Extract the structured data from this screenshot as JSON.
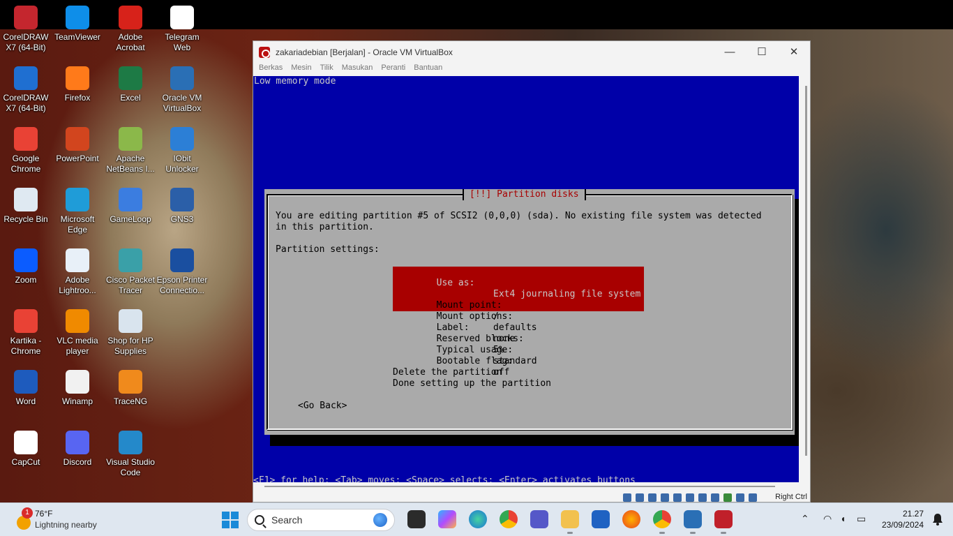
{
  "desktop": {
    "icons": [
      {
        "label": "CorelDRAW X7 (64-Bit)",
        "icon": "coreldraw-icon",
        "color": "#c4262e"
      },
      {
        "label": "TeamViewer",
        "icon": "teamviewer-icon",
        "color": "#0e8ee9"
      },
      {
        "label": "Adobe Acrobat",
        "icon": "acrobat-icon",
        "color": "#d7221a"
      },
      {
        "label": "Telegram Web",
        "icon": "file-icon",
        "color": "#ffffff"
      },
      {
        "label": "CorelDRAW X7 (64-Bit)",
        "icon": "document-icon",
        "color": "#1f6fd1"
      },
      {
        "label": "Firefox",
        "icon": "firefox-icon",
        "color": "#ff7a1a"
      },
      {
        "label": "Excel",
        "icon": "excel-icon",
        "color": "#1d7a45"
      },
      {
        "label": "Oracle VM VirtualBox",
        "icon": "virtualbox-icon",
        "color": "#2a6fb5"
      },
      {
        "label": "Google Chrome",
        "icon": "chrome-icon",
        "color": "#e94235"
      },
      {
        "label": "PowerPoint",
        "icon": "powerpoint-icon",
        "color": "#d2451e"
      },
      {
        "label": "Apache NetBeans I...",
        "icon": "netbeans-icon",
        "color": "#8bb84a"
      },
      {
        "label": "IObit Unlocker",
        "icon": "unlocker-icon",
        "color": "#2c7fd6"
      },
      {
        "label": "Recycle Bin",
        "icon": "recycle-bin-icon",
        "color": "#dfe9f2"
      },
      {
        "label": "Microsoft Edge",
        "icon": "edge-icon",
        "color": "#1f9cd8"
      },
      {
        "label": "GameLoop",
        "icon": "gameloop-icon",
        "color": "#3b7de0"
      },
      {
        "label": "GNS3",
        "icon": "gns3-icon",
        "color": "#2b5fa8"
      },
      {
        "label": "Zoom",
        "icon": "zoom-icon",
        "color": "#0b5cff"
      },
      {
        "label": "Adobe Lightroo...",
        "icon": "lightroom-icon",
        "color": "#e8f0f8"
      },
      {
        "label": "Cisco Packet Tracer",
        "icon": "packet-tracer-icon",
        "color": "#3aa0a8"
      },
      {
        "label": "Epson Printer Connectio...",
        "icon": "epson-icon",
        "color": "#1a4fa0"
      },
      {
        "label": "Kartika - Chrome",
        "icon": "chrome-profile-icon",
        "color": "#e94235"
      },
      {
        "label": "VLC media player",
        "icon": "vlc-icon",
        "color": "#f08a00"
      },
      {
        "label": "Shop for HP Supplies",
        "icon": "hp-printer-icon",
        "color": "#d9e4ee"
      },
      {
        "label": "",
        "icon": "none",
        "color": ""
      },
      {
        "label": "Word",
        "icon": "word-icon",
        "color": "#1e5bbd"
      },
      {
        "label": "Winamp",
        "icon": "winamp-icon",
        "color": "#f1f1f1"
      },
      {
        "label": "TraceNG",
        "icon": "traceng-icon",
        "color": "#f08a1c"
      },
      {
        "label": "",
        "icon": "none",
        "color": ""
      },
      {
        "label": "CapCut",
        "icon": "capcut-icon",
        "color": "#ffffff"
      },
      {
        "label": "Discord",
        "icon": "discord-icon",
        "color": "#5865f2"
      },
      {
        "label": "Visual Studio Code",
        "icon": "vscode-icon",
        "color": "#2489ca"
      }
    ]
  },
  "vbox": {
    "title": "zakariadebian [Berjalan] - Oracle VM VirtualBox",
    "menu": [
      "Berkas",
      "Mesin",
      "Tilik",
      "Masukan",
      "Peranti",
      "Bantuan"
    ],
    "window_buttons": {
      "minimize": "—",
      "maximize": "☐",
      "close": "✕"
    },
    "status_right": "Right Ctrl"
  },
  "installer": {
    "low_memory": "Low memory mode",
    "dialog_title": "[!!] Partition disks",
    "intro_line1": "You are editing partition #5 of SCSI2 (0,0,0) (sda). No existing file system was detected",
    "intro_line2": "in this partition.",
    "settings_heading": "Partition settings:",
    "selected_label": "Use as:",
    "selected_value": "Ext4 journaling file system",
    "settings": [
      {
        "label": "Mount point:",
        "value": "/"
      },
      {
        "label": "Mount options:",
        "value": "defaults"
      },
      {
        "label": "Label:",
        "value": "none"
      },
      {
        "label": "Reserved blocks:",
        "value": "5%"
      },
      {
        "label": "Typical usage:",
        "value": "standard"
      },
      {
        "label": "Bootable flag:",
        "value": "off"
      }
    ],
    "actions": [
      "Delete the partition",
      "Done setting up the partition"
    ],
    "go_back": "<Go Back>",
    "help_line": "<F1> for help; <Tab> moves; <Space> selects; <Enter> activates buttons"
  },
  "taskbar": {
    "weather_badge": "1",
    "temperature": "76°F",
    "condition": "Lightning nearby",
    "search_placeholder": "Search",
    "time": "21.27",
    "date": "23/09/2024",
    "colors": {
      "accent": "#1a8ad8",
      "taskbar_bg": "#dfe7f0"
    }
  }
}
